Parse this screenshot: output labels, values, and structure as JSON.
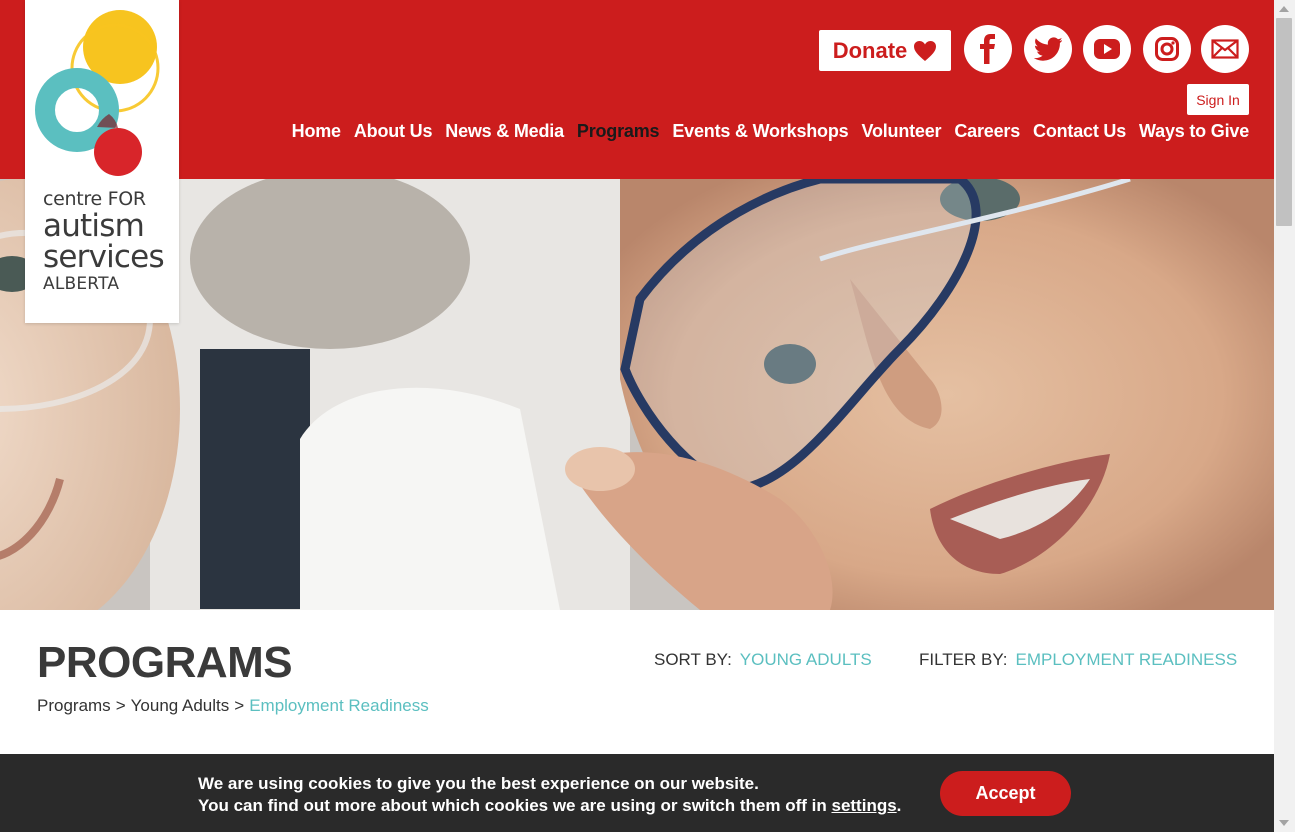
{
  "logo": {
    "line1": "centre FOR",
    "line2": "autism",
    "line3": "services",
    "line4": "ALBERTA"
  },
  "header": {
    "donate_label": "Donate",
    "signin_label": "Sign In",
    "social": [
      "facebook-icon",
      "twitter-icon",
      "youtube-icon",
      "instagram-icon",
      "email-icon"
    ]
  },
  "nav": {
    "items": [
      "Home",
      "About Us",
      "News & Media",
      "Programs",
      "Events & Workshops",
      "Volunteer",
      "Careers",
      "Contact Us",
      "Ways to Give"
    ],
    "active": "Programs"
  },
  "page": {
    "title": "PROGRAMS",
    "breadcrumb": [
      "Programs",
      ">",
      "Young Adults",
      ">",
      "Employment Readiness"
    ],
    "sort_label": "SORT BY:",
    "sort_value": "YOUNG ADULTS",
    "filter_label": "FILTER BY:",
    "filter_value": "EMPLOYMENT READINESS"
  },
  "cookie": {
    "line1": "We are using cookies to give you the best experience on our website.",
    "line2_prefix": "You can find out more about which cookies we are using or switch them off in ",
    "line2_link": "settings",
    "line2_suffix": ".",
    "accept_label": "Accept"
  },
  "colors": {
    "brand_red": "#cc1d1d",
    "accent_teal": "#5bbfc0",
    "cookie_bg": "#2a2a2a"
  }
}
